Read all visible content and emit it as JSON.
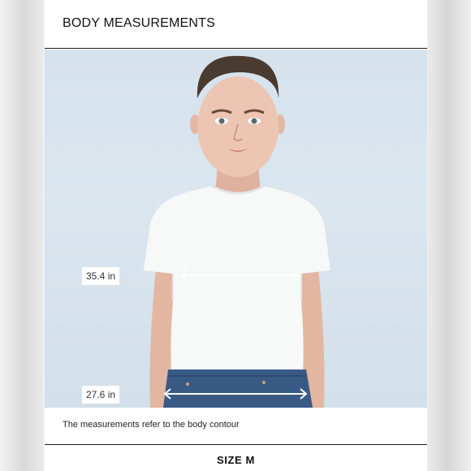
{
  "header": {
    "title": "BODY MEASUREMENTS"
  },
  "measurements": {
    "chest": "35.4 in",
    "waist": "27.6 in"
  },
  "note": "The measurements refer to the body contour",
  "size": {
    "label": "SIZE M"
  },
  "colors": {
    "background_photo": "#d6e2ec",
    "text": "#111111",
    "divider": "#1a1a1a"
  }
}
